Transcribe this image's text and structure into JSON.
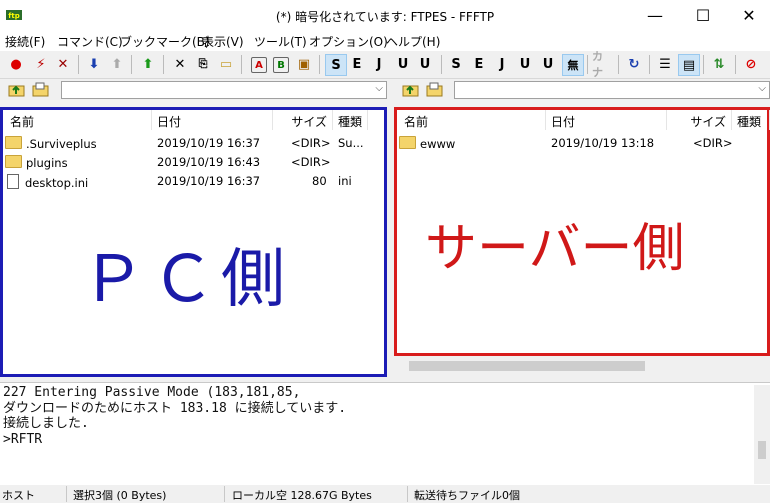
{
  "window": {
    "title": "(*) 暗号化されています: FTPES - FFFTP",
    "minimize": "—",
    "maximize": "☐",
    "close": "✕"
  },
  "menu": [
    "接続(F)",
    "コマンド(C)",
    "ブックマーク(B)",
    "表示(V)",
    "ツール(T)",
    "オプション(O)",
    "ヘルプ(H)"
  ],
  "toolbar": {
    "connect_icon": "plug-icon",
    "ascii_label": "A",
    "binary_label": "B",
    "sjis_label": "S",
    "euc_label": "E",
    "jis_label": "J",
    "utf8_label": "U",
    "none_label": "無",
    "kana_label": "カナ"
  },
  "local": {
    "path": "",
    "columns": [
      "名前",
      "日付",
      "サイズ",
      "種類"
    ],
    "files": [
      {
        "name": ".Surviveplus",
        "date": "2019/10/19 16:37",
        "size": "<DIR>",
        "type": "Su...",
        "icon": "folder-icon"
      },
      {
        "name": "plugins",
        "date": "2019/10/19 16:43",
        "size": "<DIR>",
        "type": "",
        "icon": "folder-icon"
      },
      {
        "name": "desktop.ini",
        "date": "2019/10/19 16:37",
        "size": "80",
        "type": "ini",
        "icon": "file-icon"
      }
    ],
    "overlay_label": "ＰＣ側",
    "overlay_color": "#1a1aa8",
    "border_color": "#1c1cb5"
  },
  "remote": {
    "path": "",
    "columns": [
      "名前",
      "日付",
      "サイズ",
      "種類"
    ],
    "files": [
      {
        "name": "ewww",
        "date": "2019/10/19 13:18",
        "size": "<DIR>",
        "type": "",
        "icon": "folder-icon"
      }
    ],
    "overlay_label": "サーバー側",
    "overlay_color": "#d01818",
    "border_color": "#d81c1c"
  },
  "log": {
    "lines": [
      "227 Entering Passive Mode (183,181,85,",
      "ダウンロードのためにホスト 183.18 に接続しています.",
      "接続しました.",
      ">RFTR"
    ]
  },
  "status": {
    "host": "ホスト",
    "selected": "選択3個 (0 Bytes)",
    "local_free": "ローカル空 128.67G Bytes",
    "queue": "転送待ちファイル0個"
  }
}
